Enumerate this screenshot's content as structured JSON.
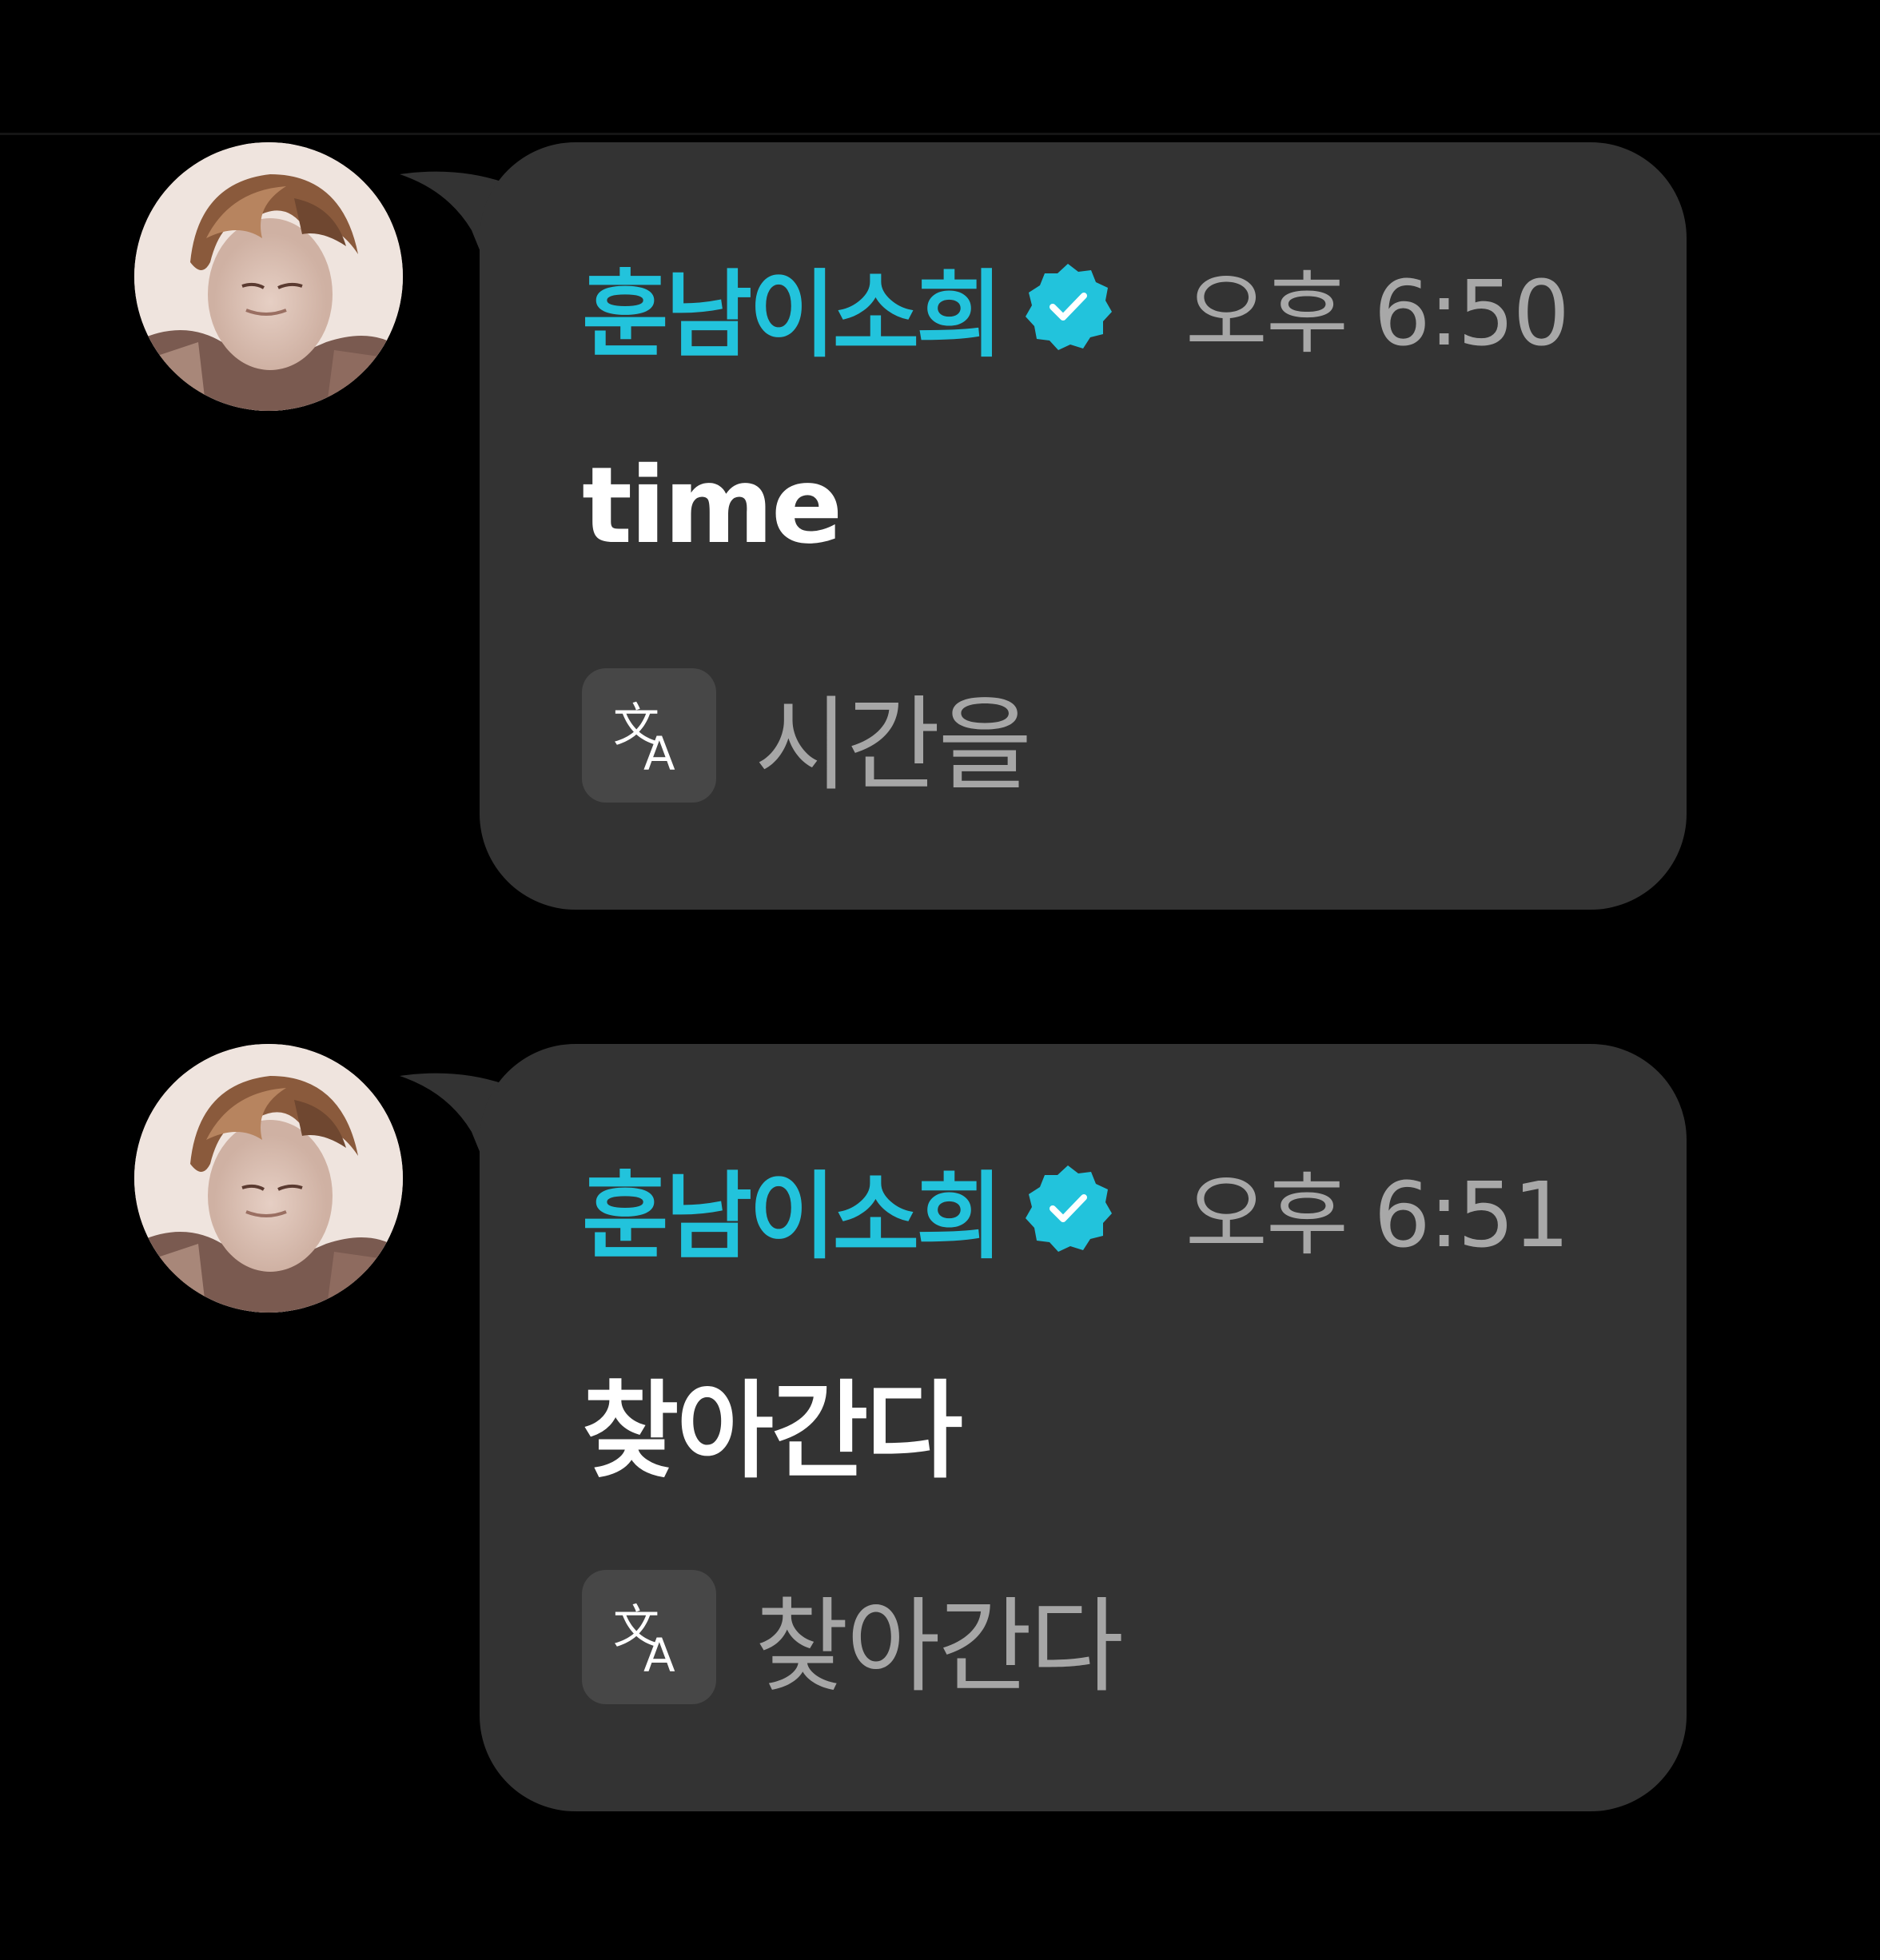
{
  "colors": {
    "background": "#000000",
    "bubble": "#333333",
    "username": "#22c3dc",
    "verified_badge": "#22c3dc",
    "timestamp": "#a8a8a8",
    "message_text": "#ffffff",
    "translation_text": "#a6a6a6",
    "translate_button": "#474747"
  },
  "messages": [
    {
      "username": "훈남이소희",
      "verified_icon": "verified-badge-icon",
      "time": "오후 6:50",
      "text": "time",
      "translate_icon": "translate-icon",
      "translation": "시간을"
    },
    {
      "username": "훈남이소희",
      "verified_icon": "verified-badge-icon",
      "time": "오후 6:51",
      "text": "찾아간다",
      "translate_icon": "translate-icon",
      "translation": "찾아간다"
    }
  ]
}
